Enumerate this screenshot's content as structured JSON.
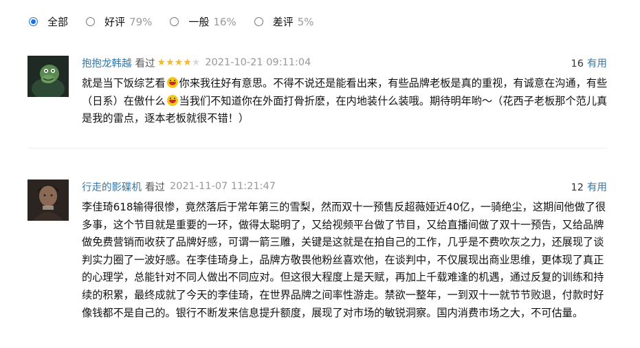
{
  "filters": [
    {
      "label": "全部",
      "pct": "",
      "checked": true
    },
    {
      "label": "好评",
      "pct": "79%",
      "checked": false
    },
    {
      "label": "一般",
      "pct": "16%",
      "checked": false
    },
    {
      "label": "差评",
      "pct": "5%",
      "checked": false
    }
  ],
  "reviews": [
    {
      "author": "抱抱龙韩越",
      "status": "看过",
      "rating": 4,
      "rating_max": 5,
      "time": "2021-10-21 09:11:04",
      "votes": "16",
      "useful_label": "有用",
      "text_parts": [
        "就是当下饭综艺看",
        "你来我往好有意思。不得不说还是能看出来，有些品牌老板是真的重视，有诚意在沟通，有些（日系）在傲什么",
        "当我们不知道你在外面打骨折麽，在内地装什么装哦。期待明年哟～（花西子老板那个范儿真是我的雷点，逐本老板就很不错！）"
      ]
    },
    {
      "author": "行走的影碟机",
      "status": "看过",
      "time": "2021-11-07 11:21:47",
      "votes": "12",
      "useful_label": "有用",
      "text": "李佳琦618输得很惨，竟然落后于常年第三的雪梨，然而双十一预售反超薇娅近40亿，一骑绝尘，这期间他做了很多事，这个节目就是重要的一环，做得太聪明了，又给视频平台做了节目，又给直播间做了双十一预告，又给品牌做免费营销而收获了品牌好感，可谓一箭三雕，关键是这就是在拍自己的工作，几乎是不费吹灰之力，还展现了谈判实力圈了一波好感。在李佳琦身上，品牌方敬畏他粉丝喜欢他，在谈判中，不仅展现出商业思维，更体现了真正的心理学，总能针对不同人做出不同应对。但这很大程度上是天赋，再加上千载难逢的机遇，通过反复的训练和持续的积累，最终成就了今天的李佳琦，在世界品牌之间率性游走。禁欲一整年，一到双十一就节节败退，付款时好像钱都不是自己的。银行不断发来信息提升额度，展现了对市场的敏锐洞察。国内消费市场之大，不可估量。"
    }
  ],
  "colors": {
    "link": "#3377aa",
    "star": "#f7b829",
    "radio_checked": "#1a73e8"
  },
  "icons": [
    "radio-checked-icon",
    "radio-icon",
    "star-icon",
    "laugh-emoji-icon"
  ]
}
